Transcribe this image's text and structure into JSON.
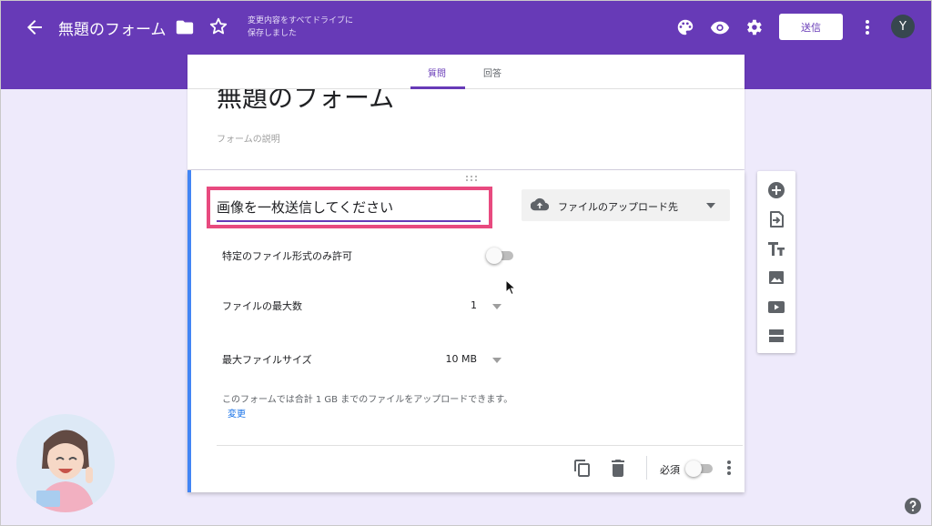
{
  "header": {
    "form_title": "無題のフォーム",
    "save_status_line1": "変更内容をすべてドライブに",
    "save_status_line2": "保存しました",
    "send_label": "送信",
    "avatar_initial": "Y",
    "accent_color": "#673ab7"
  },
  "tabs": {
    "questions": "質問",
    "responses": "回答"
  },
  "form": {
    "title": "無題のフォーム",
    "description_placeholder": "フォームの説明"
  },
  "question": {
    "title": "画像を一枚送信してください",
    "type_label": "ファイルのアップロード先",
    "allow_specific_types_label": "特定のファイル形式のみ許可",
    "max_files_label": "ファイルの最大数",
    "max_files_value": "1",
    "max_size_label": "最大ファイルサイズ",
    "max_size_value": "10 MB",
    "info_text": "このフォームでは合計 1 GB までのファイルをアップロードできます。",
    "info_link": "変更",
    "required_label": "必須",
    "highlight_color": "#e84a7f"
  },
  "toolbar_icons": [
    "add-question-icon",
    "import-questions-icon",
    "add-title-icon",
    "add-image-icon",
    "add-video-icon",
    "add-section-icon"
  ]
}
